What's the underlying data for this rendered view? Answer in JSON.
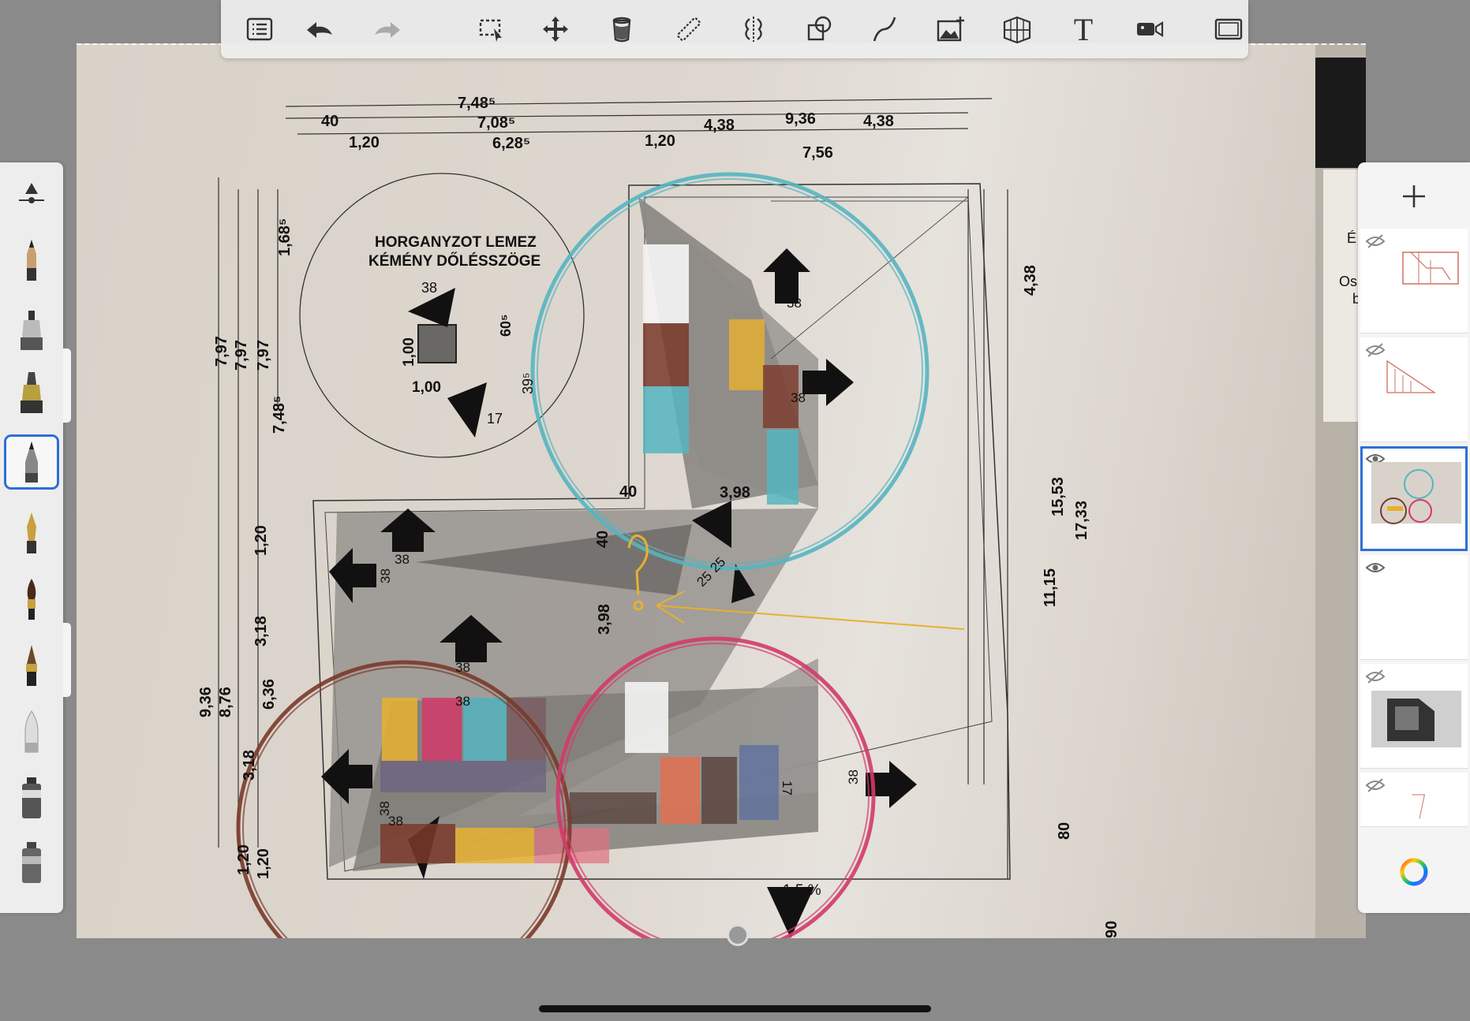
{
  "app": {
    "name": "Sketchbook"
  },
  "toolbar": {
    "tools": [
      {
        "name": "layer-list",
        "icon": "list-icon"
      },
      {
        "name": "undo",
        "icon": "undo-icon"
      },
      {
        "name": "redo",
        "icon": "redo-icon"
      },
      {
        "name": "selection",
        "icon": "selection-icon"
      },
      {
        "name": "transform",
        "icon": "move-icon"
      },
      {
        "name": "fill",
        "icon": "bucket-icon"
      },
      {
        "name": "ruler",
        "icon": "ruler-icon"
      },
      {
        "name": "symmetry",
        "icon": "symmetry-icon"
      },
      {
        "name": "shapes",
        "icon": "shapes-icon"
      },
      {
        "name": "curve",
        "icon": "curve-icon"
      },
      {
        "name": "add-image",
        "icon": "add-image-icon"
      },
      {
        "name": "perspective",
        "icon": "perspective-icon"
      },
      {
        "name": "text",
        "icon": "text-icon",
        "label": "T"
      },
      {
        "name": "time-lapse",
        "icon": "video-icon"
      },
      {
        "name": "fullscreen",
        "icon": "fullscreen-icon"
      }
    ]
  },
  "brushes": [
    {
      "name": "brush-size-control",
      "icon": "brush-size-icon"
    },
    {
      "name": "pencil",
      "icon": "pencil-icon"
    },
    {
      "name": "marker",
      "icon": "marker-icon"
    },
    {
      "name": "airbrush",
      "icon": "airbrush-icon"
    },
    {
      "name": "ballpoint",
      "icon": "ballpoint-icon",
      "selected": true
    },
    {
      "name": "ink-pen",
      "icon": "ink-pen-icon"
    },
    {
      "name": "paintbrush",
      "icon": "paintbrush-icon"
    },
    {
      "name": "chisel-brush",
      "icon": "chisel-brush-icon"
    },
    {
      "name": "soft-eraser",
      "icon": "eraser-icon"
    },
    {
      "name": "felt-marker",
      "icon": "felt-marker-icon"
    },
    {
      "name": "paint-tube",
      "icon": "paint-tube-icon"
    }
  ],
  "layers": [
    {
      "name": "layer-1",
      "visible": false
    },
    {
      "name": "layer-2",
      "visible": false
    },
    {
      "name": "layer-3",
      "visible": true,
      "active": true
    },
    {
      "name": "layer-4",
      "visible": true
    },
    {
      "name": "layer-5",
      "visible": false
    },
    {
      "name": "layer-6",
      "visible": false
    }
  ],
  "drawing": {
    "top_dims": {
      "d1": "7,48⁵",
      "d2": "40",
      "d3": "7,08⁵",
      "d4": "4,38",
      "d5": "9,36",
      "d6": "4,38",
      "d7": "1,20",
      "d8": "6,28⁵",
      "d9": "1,20",
      "d10": "7,56"
    },
    "left_dims": {
      "l1": "7,97",
      "l2": "7,97",
      "l3": "7,97",
      "l4": "7,48⁵",
      "l5": "1,68⁵",
      "l6": "1,20",
      "l7": "3,18",
      "l8": "9,36",
      "l9": "8,76",
      "l10": "6,36",
      "l11": "3,18",
      "l12": "1,20",
      "l13": "1,20"
    },
    "right_dims": {
      "r1": "4,38",
      "r2": "15,53",
      "r3": "17,33",
      "r4": "11,15",
      "r5": "80",
      "r6": "90"
    },
    "circle_title_1": "HORGANYZOT LEMEZ",
    "circle_title_2": "KÉMÉNY DŐLÉSSZÖGE",
    "circle_dims": {
      "c1": "38",
      "c2": "1,00",
      "c3": "60⁵",
      "c4": "1,00",
      "c5": "17",
      "c6": "39⁵"
    },
    "inner_dims": {
      "i1": "38",
      "i2": "38",
      "i3": "40",
      "i4": "3,98",
      "i5": "38",
      "i6": "38",
      "i7": "40",
      "i8": "3,98",
      "i9": "25",
      "i10": "25",
      "i11": "38",
      "i12": "38",
      "i13": "38",
      "i14": "38",
      "i15": "38",
      "i16": "17",
      "i17": "1,5 %"
    },
    "side_text": {
      "s1": "É",
      "s2": "Os",
      "s3": "b"
    },
    "sketch_colors": {
      "cyan": "#55b5c0",
      "brown": "#7a3a2a",
      "pink": "#d23a6a",
      "yellow": "#e8b030",
      "orange": "#e09040",
      "white": "#f4f4f4"
    }
  }
}
